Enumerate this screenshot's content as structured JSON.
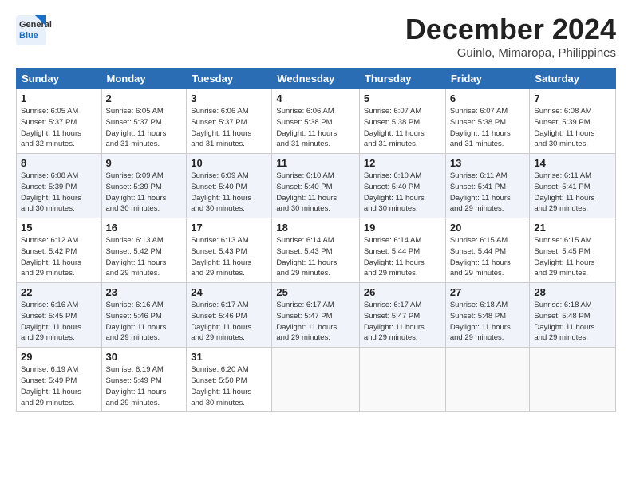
{
  "header": {
    "logo_line1": "General",
    "logo_line2": "Blue",
    "month": "December 2024",
    "location": "Guinlo, Mimaropa, Philippines"
  },
  "days_of_week": [
    "Sunday",
    "Monday",
    "Tuesday",
    "Wednesday",
    "Thursday",
    "Friday",
    "Saturday"
  ],
  "weeks": [
    [
      {
        "day": "1",
        "info": "Sunrise: 6:05 AM\nSunset: 5:37 PM\nDaylight: 11 hours\nand 32 minutes."
      },
      {
        "day": "2",
        "info": "Sunrise: 6:05 AM\nSunset: 5:37 PM\nDaylight: 11 hours\nand 31 minutes."
      },
      {
        "day": "3",
        "info": "Sunrise: 6:06 AM\nSunset: 5:37 PM\nDaylight: 11 hours\nand 31 minutes."
      },
      {
        "day": "4",
        "info": "Sunrise: 6:06 AM\nSunset: 5:38 PM\nDaylight: 11 hours\nand 31 minutes."
      },
      {
        "day": "5",
        "info": "Sunrise: 6:07 AM\nSunset: 5:38 PM\nDaylight: 11 hours\nand 31 minutes."
      },
      {
        "day": "6",
        "info": "Sunrise: 6:07 AM\nSunset: 5:38 PM\nDaylight: 11 hours\nand 31 minutes."
      },
      {
        "day": "7",
        "info": "Sunrise: 6:08 AM\nSunset: 5:39 PM\nDaylight: 11 hours\nand 30 minutes."
      }
    ],
    [
      {
        "day": "8",
        "info": "Sunrise: 6:08 AM\nSunset: 5:39 PM\nDaylight: 11 hours\nand 30 minutes."
      },
      {
        "day": "9",
        "info": "Sunrise: 6:09 AM\nSunset: 5:39 PM\nDaylight: 11 hours\nand 30 minutes."
      },
      {
        "day": "10",
        "info": "Sunrise: 6:09 AM\nSunset: 5:40 PM\nDaylight: 11 hours\nand 30 minutes."
      },
      {
        "day": "11",
        "info": "Sunrise: 6:10 AM\nSunset: 5:40 PM\nDaylight: 11 hours\nand 30 minutes."
      },
      {
        "day": "12",
        "info": "Sunrise: 6:10 AM\nSunset: 5:40 PM\nDaylight: 11 hours\nand 30 minutes."
      },
      {
        "day": "13",
        "info": "Sunrise: 6:11 AM\nSunset: 5:41 PM\nDaylight: 11 hours\nand 29 minutes."
      },
      {
        "day": "14",
        "info": "Sunrise: 6:11 AM\nSunset: 5:41 PM\nDaylight: 11 hours\nand 29 minutes."
      }
    ],
    [
      {
        "day": "15",
        "info": "Sunrise: 6:12 AM\nSunset: 5:42 PM\nDaylight: 11 hours\nand 29 minutes."
      },
      {
        "day": "16",
        "info": "Sunrise: 6:13 AM\nSunset: 5:42 PM\nDaylight: 11 hours\nand 29 minutes."
      },
      {
        "day": "17",
        "info": "Sunrise: 6:13 AM\nSunset: 5:43 PM\nDaylight: 11 hours\nand 29 minutes."
      },
      {
        "day": "18",
        "info": "Sunrise: 6:14 AM\nSunset: 5:43 PM\nDaylight: 11 hours\nand 29 minutes."
      },
      {
        "day": "19",
        "info": "Sunrise: 6:14 AM\nSunset: 5:44 PM\nDaylight: 11 hours\nand 29 minutes."
      },
      {
        "day": "20",
        "info": "Sunrise: 6:15 AM\nSunset: 5:44 PM\nDaylight: 11 hours\nand 29 minutes."
      },
      {
        "day": "21",
        "info": "Sunrise: 6:15 AM\nSunset: 5:45 PM\nDaylight: 11 hours\nand 29 minutes."
      }
    ],
    [
      {
        "day": "22",
        "info": "Sunrise: 6:16 AM\nSunset: 5:45 PM\nDaylight: 11 hours\nand 29 minutes."
      },
      {
        "day": "23",
        "info": "Sunrise: 6:16 AM\nSunset: 5:46 PM\nDaylight: 11 hours\nand 29 minutes."
      },
      {
        "day": "24",
        "info": "Sunrise: 6:17 AM\nSunset: 5:46 PM\nDaylight: 11 hours\nand 29 minutes."
      },
      {
        "day": "25",
        "info": "Sunrise: 6:17 AM\nSunset: 5:47 PM\nDaylight: 11 hours\nand 29 minutes."
      },
      {
        "day": "26",
        "info": "Sunrise: 6:17 AM\nSunset: 5:47 PM\nDaylight: 11 hours\nand 29 minutes."
      },
      {
        "day": "27",
        "info": "Sunrise: 6:18 AM\nSunset: 5:48 PM\nDaylight: 11 hours\nand 29 minutes."
      },
      {
        "day": "28",
        "info": "Sunrise: 6:18 AM\nSunset: 5:48 PM\nDaylight: 11 hours\nand 29 minutes."
      }
    ],
    [
      {
        "day": "29",
        "info": "Sunrise: 6:19 AM\nSunset: 5:49 PM\nDaylight: 11 hours\nand 29 minutes."
      },
      {
        "day": "30",
        "info": "Sunrise: 6:19 AM\nSunset: 5:49 PM\nDaylight: 11 hours\nand 29 minutes."
      },
      {
        "day": "31",
        "info": "Sunrise: 6:20 AM\nSunset: 5:50 PM\nDaylight: 11 hours\nand 30 minutes."
      },
      {
        "day": "",
        "info": ""
      },
      {
        "day": "",
        "info": ""
      },
      {
        "day": "",
        "info": ""
      },
      {
        "day": "",
        "info": ""
      }
    ]
  ]
}
